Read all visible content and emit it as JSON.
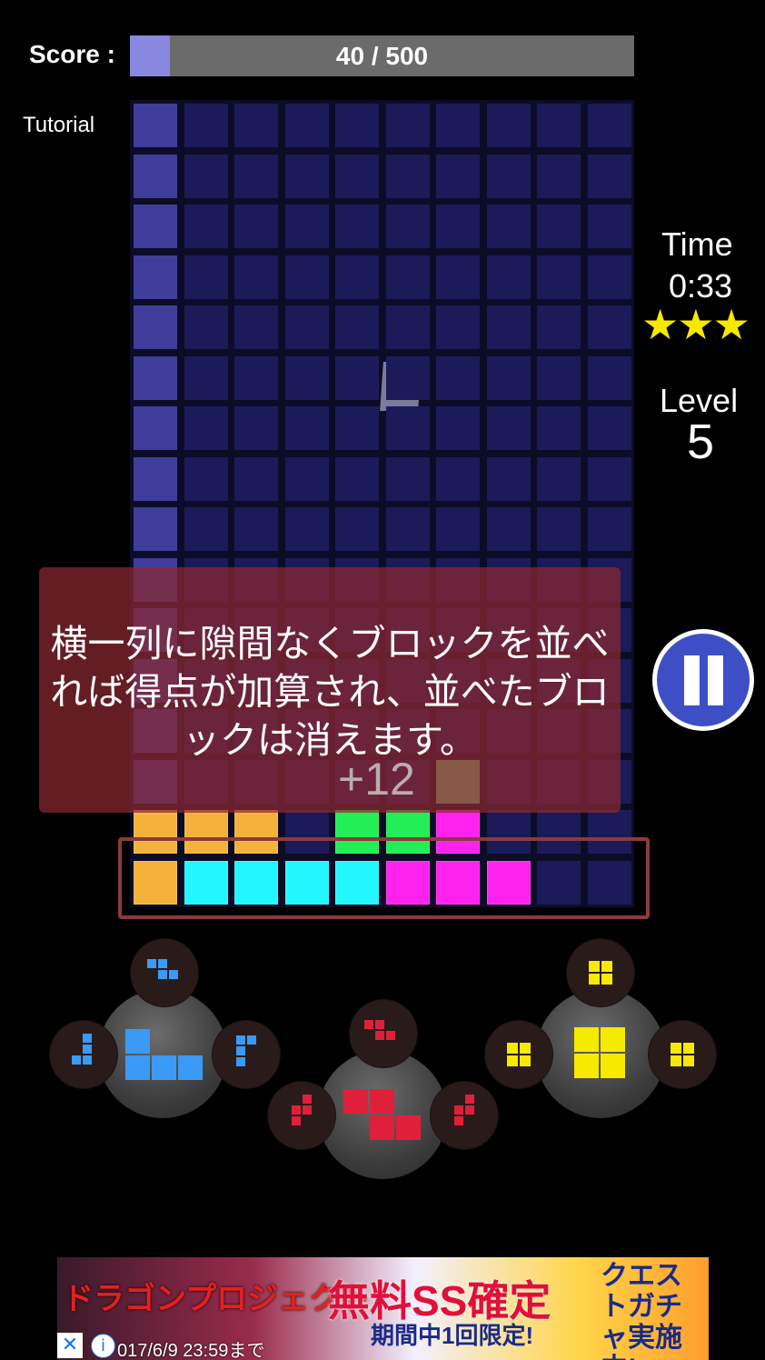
{
  "hud": {
    "score_label": "Score :",
    "score_text": "40 / 500",
    "score_progress": 0.08,
    "mode_label": "Tutorial",
    "time_label": "Time",
    "time_value": "0:33",
    "stars": "★★★",
    "level_label": "Level",
    "level_value": "5"
  },
  "board": {
    "columns": 10,
    "rows": 16,
    "filled_rows": [
      [
        "#f5b23a",
        "#f5b23a",
        "#f5b23a",
        null,
        "#22ee55",
        "#22ee55",
        "#ff22ee",
        null,
        null,
        null
      ],
      [
        "#f5b23a",
        "#22f7ff",
        "#22f7ff",
        "#22f7ff",
        "#22f7ff",
        "#ff22ee",
        "#ff22ee",
        "#ff22ee",
        null,
        null
      ]
    ],
    "top_partial": {
      "col": 6,
      "color": "#7fd77f"
    }
  },
  "tutorial": {
    "message": "横一列に隙間なくブロックを並べれば得点が加算され、並べたブロックは消えます。",
    "bonus": "+12"
  },
  "controls": {
    "piece_colors": [
      "#3a9af5",
      "#e0203a",
      "#f5ea00"
    ],
    "pause_icon": "pause-icon"
  },
  "ad": {
    "logo": "ドラゴンプロジェクト",
    "headline": "無料SS確定",
    "sub": "期間中1回限定!",
    "right": "クエストガチャ実施中!",
    "date": "017/6/9 23:59まで",
    "close": "✕",
    "info": "i"
  }
}
